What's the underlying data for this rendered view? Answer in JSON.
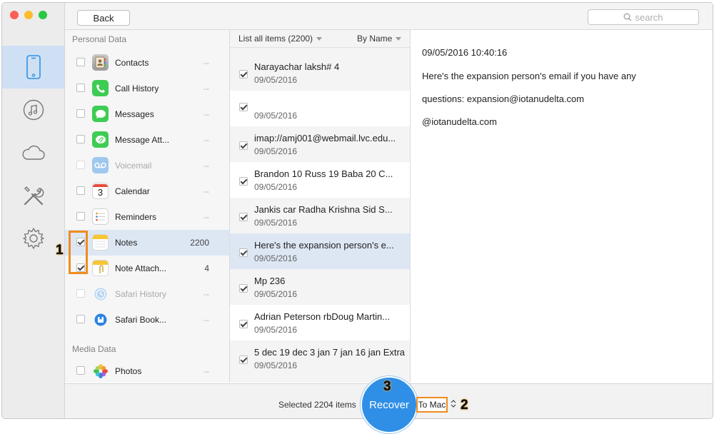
{
  "toolbar": {
    "back_label": "Back",
    "search_placeholder": "search"
  },
  "sidebar": {
    "icons": [
      "device-icon",
      "music-icon",
      "cloud-icon",
      "tools-icon",
      "gear-icon"
    ]
  },
  "categories": {
    "personal_title": "Personal Data",
    "media_title": "Media Data",
    "items": [
      {
        "label": "Contacts",
        "count": "--",
        "checked": false,
        "disabled": false
      },
      {
        "label": "Call History",
        "count": "--",
        "checked": false,
        "disabled": false
      },
      {
        "label": "Messages",
        "count": "--",
        "checked": false,
        "disabled": false
      },
      {
        "label": "Message Att...",
        "count": "--",
        "checked": false,
        "disabled": false
      },
      {
        "label": "Voicemail",
        "count": "--",
        "checked": false,
        "disabled": true
      },
      {
        "label": "Calendar",
        "count": "--",
        "checked": false,
        "disabled": false
      },
      {
        "label": "Reminders",
        "count": "--",
        "checked": false,
        "disabled": false
      },
      {
        "label": "Notes",
        "count": "2200",
        "checked": true,
        "disabled": false
      },
      {
        "label": "Note Attach...",
        "count": "4",
        "checked": true,
        "disabled": false
      },
      {
        "label": "Safari History",
        "count": "--",
        "checked": false,
        "disabled": true
      },
      {
        "label": "Safari Book...",
        "count": "--",
        "checked": false,
        "disabled": false
      }
    ],
    "media_items": [
      {
        "label": "Photos",
        "count": "--",
        "checked": false,
        "disabled": false
      }
    ],
    "calendar_day": "3"
  },
  "list": {
    "header_left": "List all items (2200)",
    "header_right": "By Name",
    "items": [
      {
        "title": "Narayachar laksh# 4",
        "date": "09/05/2016"
      },
      {
        "title": "",
        "date": "09/05/2016"
      },
      {
        "title": "imap://amj001@webmail.lvc.edu...",
        "date": "09/05/2016"
      },
      {
        "title": "Brandon 10 Russ 19 Baba 20 C...",
        "date": "09/05/2016"
      },
      {
        "title": "Jankis car Radha Krishna Sid S...",
        "date": "09/05/2016"
      },
      {
        "title": "Here's the expansion person's e...",
        "date": "09/05/2016"
      },
      {
        "title": "Mp 236",
        "date": "09/05/2016"
      },
      {
        "title": "Adrian Peterson rbDoug Martin...",
        "date": "09/05/2016"
      },
      {
        "title": "5 dec 19 dec 3 jan 7 jan 16 jan Extra",
        "date": "09/05/2016"
      }
    ]
  },
  "detail": {
    "timestamp": "09/05/2016 10:40:16",
    "lines": [
      "Here's the expansion person's email if you have any",
      "questions: expansion@iotanudelta.com",
      "@iotanudelta.com"
    ]
  },
  "bottom": {
    "selected_text": "Selected 2204 items",
    "recover_label": "Recover",
    "destination": "To Mac"
  },
  "callouts": {
    "one": "1",
    "two": "2",
    "three": "3"
  },
  "colors": {
    "accent": "#2f8fe6",
    "callout": "#f08c1e",
    "selection": "#dde7f4"
  }
}
